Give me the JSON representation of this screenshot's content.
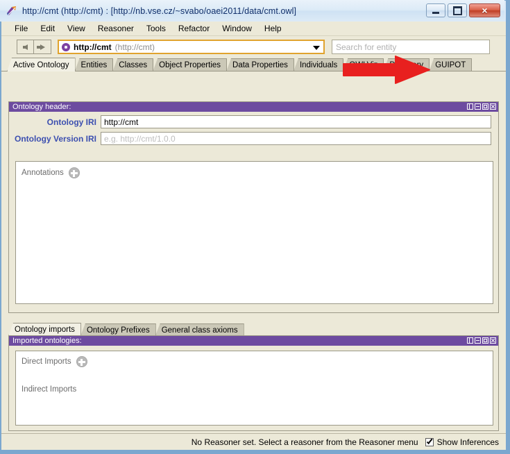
{
  "window": {
    "title": "http://cmt (http://cmt)  : [http://nb.vse.cz/~svabo/oaei2011/data/cmt.owl]",
    "app_icon": "protege-icon",
    "minimize_label": "",
    "maximize_label": "",
    "close_label": "×"
  },
  "menu": {
    "items": [
      "File",
      "Edit",
      "View",
      "Reasoner",
      "Tools",
      "Refactor",
      "Window",
      "Help"
    ]
  },
  "toolbar": {
    "back_label": "",
    "forward_label": "",
    "ontology_selector": {
      "icon": "ontology-icon",
      "name": "http://cmt",
      "alt": "(http://cmt)"
    },
    "search_placeholder": "Search for entity"
  },
  "tabs": {
    "items": [
      {
        "label": "Active Ontology",
        "active": true
      },
      {
        "label": "Entities",
        "active": false
      },
      {
        "label": "Classes",
        "active": false
      },
      {
        "label": "Object Properties",
        "active": false
      },
      {
        "label": "Data Properties",
        "active": false
      },
      {
        "label": "Individuals",
        "active": false
      },
      {
        "label": "OWLViz",
        "active": false
      },
      {
        "label": "DL Query",
        "active": false
      },
      {
        "label": "GUIPOT",
        "active": false
      }
    ]
  },
  "annotation": {
    "type": "red-arrow",
    "color": "#e8201f",
    "points_to": "GUIPOT"
  },
  "ontology_header": {
    "title": "Ontology header:",
    "iri_label": "Ontology IRI",
    "iri_value": "http://cmt",
    "version_label": "Ontology Version IRI",
    "version_placeholder": "e.g. http://cmt/1.0.0",
    "annotations_label": "Annotations",
    "annotations_add": "add-annotation"
  },
  "lower_tabs": {
    "items": [
      {
        "label": "Ontology imports",
        "active": true
      },
      {
        "label": "Ontology Prefixes",
        "active": false
      },
      {
        "label": "General class axioms",
        "active": false
      }
    ]
  },
  "imports_panel": {
    "title": "Imported ontologies:",
    "direct_label": "Direct Imports",
    "direct_add": "add-direct-import",
    "indirect_label": "Indirect Imports"
  },
  "panel_buttons": {
    "split": "split-pane-icon",
    "minimize": "minimize-panel-icon",
    "maximize": "maximize-panel-icon",
    "close": "close-panel-icon"
  },
  "statusbar": {
    "message": "No Reasoner set. Select a reasoner from the Reasoner menu",
    "show_inferences_label": "Show Inferences",
    "show_inferences_checked": true
  },
  "colors": {
    "panel_header": "#6d4ba0",
    "window_bg": "#ece9d8",
    "label_blue": "#3c4fb0",
    "annotation_red": "#e8201f",
    "combo_border": "#e0a32e"
  }
}
